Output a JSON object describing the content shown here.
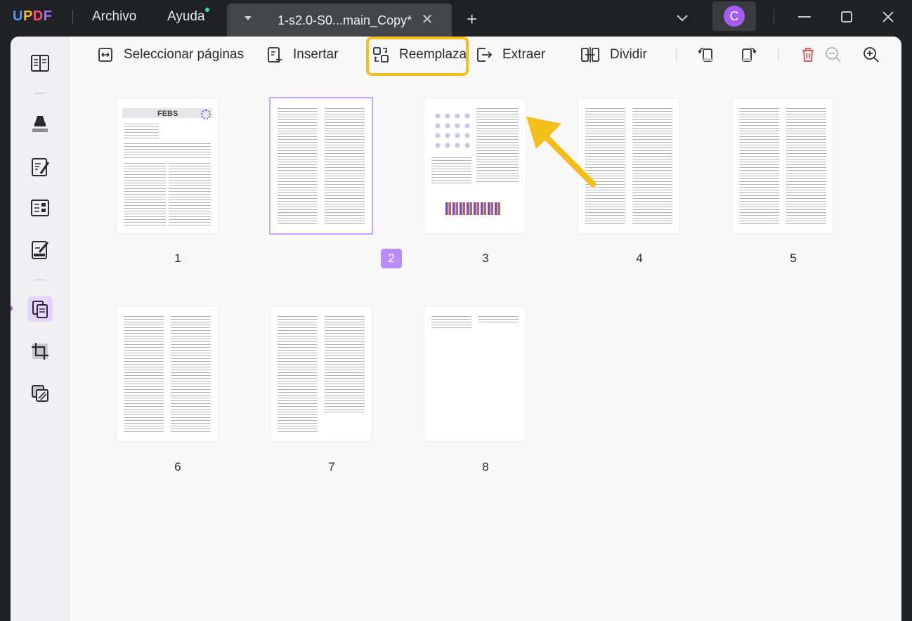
{
  "app": {
    "logo": "UPDF",
    "menu": [
      {
        "label": "Archivo"
      },
      {
        "label": "Ayuda"
      }
    ],
    "tab_title": "1-s2.0-S0...main_Copy*",
    "avatar_initial": "C"
  },
  "toolbar": {
    "select_pages": "Seleccionar páginas",
    "insert": "Insertar",
    "replace": "Reemplaza",
    "extract": "Extraer",
    "split": "Dividir"
  },
  "pages": [
    {
      "number": "1",
      "selected": false
    },
    {
      "number": "2",
      "selected": true
    },
    {
      "number": "3",
      "selected": false
    },
    {
      "number": "4",
      "selected": false
    },
    {
      "number": "5",
      "selected": false
    },
    {
      "number": "6",
      "selected": false
    },
    {
      "number": "7",
      "selected": false
    },
    {
      "number": "8",
      "selected": false
    }
  ],
  "colors": {
    "accent": "#a55cf5",
    "highlight": "#f6be1a",
    "delete": "#e5484d"
  }
}
